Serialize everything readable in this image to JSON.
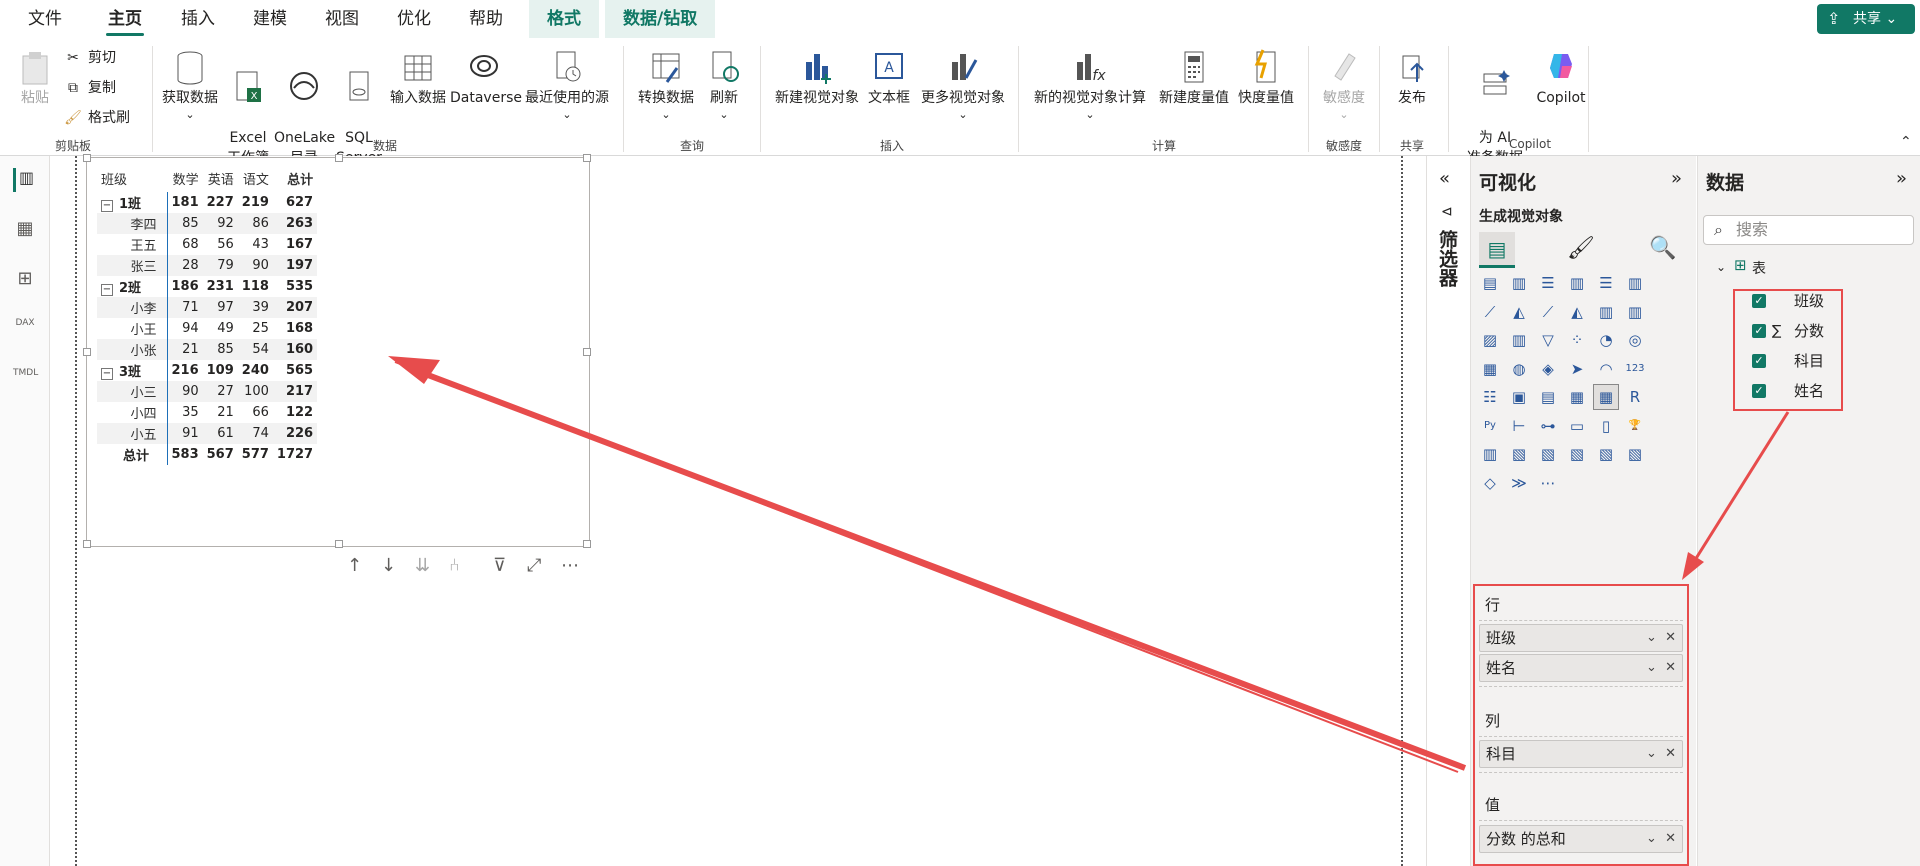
{
  "tabs": [
    "文件",
    "主页",
    "插入",
    "建模",
    "视图",
    "优化",
    "帮助"
  ],
  "active_tab": "主页",
  "context_tabs": [
    "格式",
    "数据/钻取"
  ],
  "share_label": "共享",
  "ribbon": {
    "clipboard": {
      "paste": "粘贴",
      "cut": "剪切",
      "copy": "复制",
      "format_painter": "格式刷",
      "group": "剪贴板"
    },
    "data": {
      "get_data": "获取数据",
      "excel": "Excel\n工作簿",
      "onelake": "OneLake\n目录",
      "sql": "SQL\nServer",
      "enter_data": "输入数据",
      "dataverse": "Dataverse",
      "recent": "最近使用的源",
      "group": "数据"
    },
    "query": {
      "transform": "转换数据",
      "refresh": "刷新",
      "group": "查询"
    },
    "insert": {
      "new_visual": "新建视觉对象",
      "textbox": "文本框",
      "more_visuals": "更多视觉对象",
      "group": "插入"
    },
    "calc": {
      "new_visual_calc": "新的视觉对象计算",
      "new_measure": "新建度量值",
      "quick_measure": "快度量值",
      "group": "计算"
    },
    "sensitivity": {
      "label": "敏感度",
      "group": "敏感度"
    },
    "share": {
      "publish": "发布",
      "group": "共享"
    },
    "copilot": {
      "ai_prep": "为 AI\n准备数据",
      "copilot": "Copilot",
      "group": "Copilot"
    }
  },
  "matrix": {
    "headers": [
      "班级",
      "数学",
      "英语",
      "语文",
      "总计"
    ],
    "groups": [
      {
        "name": "1班",
        "values": [
          "181",
          "227",
          "219",
          "627"
        ],
        "children": [
          {
            "name": "李四",
            "values": [
              "85",
              "92",
              "86",
              "263"
            ]
          },
          {
            "name": "王五",
            "values": [
              "68",
              "56",
              "43",
              "167"
            ]
          },
          {
            "name": "张三",
            "values": [
              "28",
              "79",
              "90",
              "197"
            ]
          }
        ]
      },
      {
        "name": "2班",
        "values": [
          "186",
          "231",
          "118",
          "535"
        ],
        "children": [
          {
            "name": "小李",
            "values": [
              "71",
              "97",
              "39",
              "207"
            ]
          },
          {
            "name": "小王",
            "values": [
              "94",
              "49",
              "25",
              "168"
            ]
          },
          {
            "name": "小张",
            "values": [
              "21",
              "85",
              "54",
              "160"
            ]
          }
        ]
      },
      {
        "name": "3班",
        "values": [
          "216",
          "109",
          "240",
          "565"
        ],
        "children": [
          {
            "name": "小三",
            "values": [
              "90",
              "27",
              "100",
              "217"
            ]
          },
          {
            "name": "小四",
            "values": [
              "35",
              "21",
              "66",
              "122"
            ]
          },
          {
            "name": "小五",
            "values": [
              "91",
              "61",
              "74",
              "226"
            ]
          }
        ]
      }
    ],
    "total": {
      "name": "总计",
      "values": [
        "583",
        "567",
        "577",
        "1727"
      ]
    }
  },
  "filters_label": "筛选器",
  "viz_pane": {
    "title": "可视化",
    "subtitle": "生成视觉对象"
  },
  "wells": {
    "rows_label": "行",
    "rows": [
      "班级",
      "姓名"
    ],
    "cols_label": "列",
    "cols": [
      "科目"
    ],
    "values_label": "值",
    "values": [
      "分数 的总和"
    ]
  },
  "data_pane": {
    "title": "数据",
    "search_placeholder": "搜索",
    "table": "表",
    "fields": [
      {
        "name": "班级",
        "sigma": false
      },
      {
        "name": "分数",
        "sigma": true
      },
      {
        "name": "科目",
        "sigma": false
      },
      {
        "name": "姓名",
        "sigma": false
      }
    ]
  },
  "colors": {
    "accent": "#117865",
    "annotation": "#e74c4c"
  }
}
